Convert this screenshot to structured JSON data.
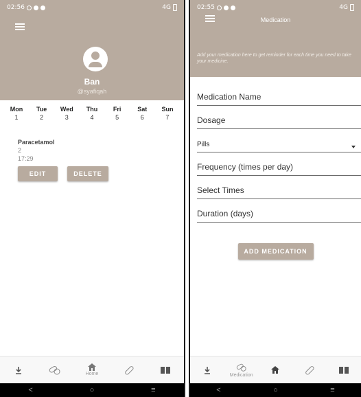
{
  "colors": {
    "accent": "#b8ab9f",
    "system_bar": "#000000"
  },
  "left_screen": {
    "status": {
      "time": "02:56",
      "right": "4G"
    },
    "profile": {
      "name": "Ban",
      "handle": "@syafiqah"
    },
    "week": [
      {
        "day": "Mon",
        "num": "1"
      },
      {
        "day": "Tue",
        "num": "2"
      },
      {
        "day": "Wed",
        "num": "3"
      },
      {
        "day": "Thu",
        "num": "4"
      },
      {
        "day": "Fri",
        "num": "5"
      },
      {
        "day": "Sat",
        "num": "6"
      },
      {
        "day": "Sun",
        "num": "7"
      }
    ],
    "medication": {
      "name": "Paracetamol",
      "dosage": "2",
      "time": "17:29",
      "edit_label": "EDIT",
      "delete_label": "DELETE"
    },
    "nav": {
      "home_label": "Home"
    },
    "sysbar": {
      "back": "<",
      "home": "○",
      "recents": "≡"
    }
  },
  "right_screen": {
    "status": {
      "time": "02:55",
      "right": "4G"
    },
    "title": "Medication",
    "hint": "Add your medication here to get reminder for each time you need to take your medicine.",
    "fields": {
      "name": "Medication Name",
      "dosage": "Dosage",
      "type": "Pills",
      "frequency": "Frequency (times per day)",
      "times": "Select Times",
      "duration": "Duration (days)"
    },
    "add_label": "ADD MEDICATION",
    "nav": {
      "medication_label": "Medication"
    },
    "sysbar": {
      "back": "<",
      "home": "○",
      "recents": "≡"
    }
  }
}
